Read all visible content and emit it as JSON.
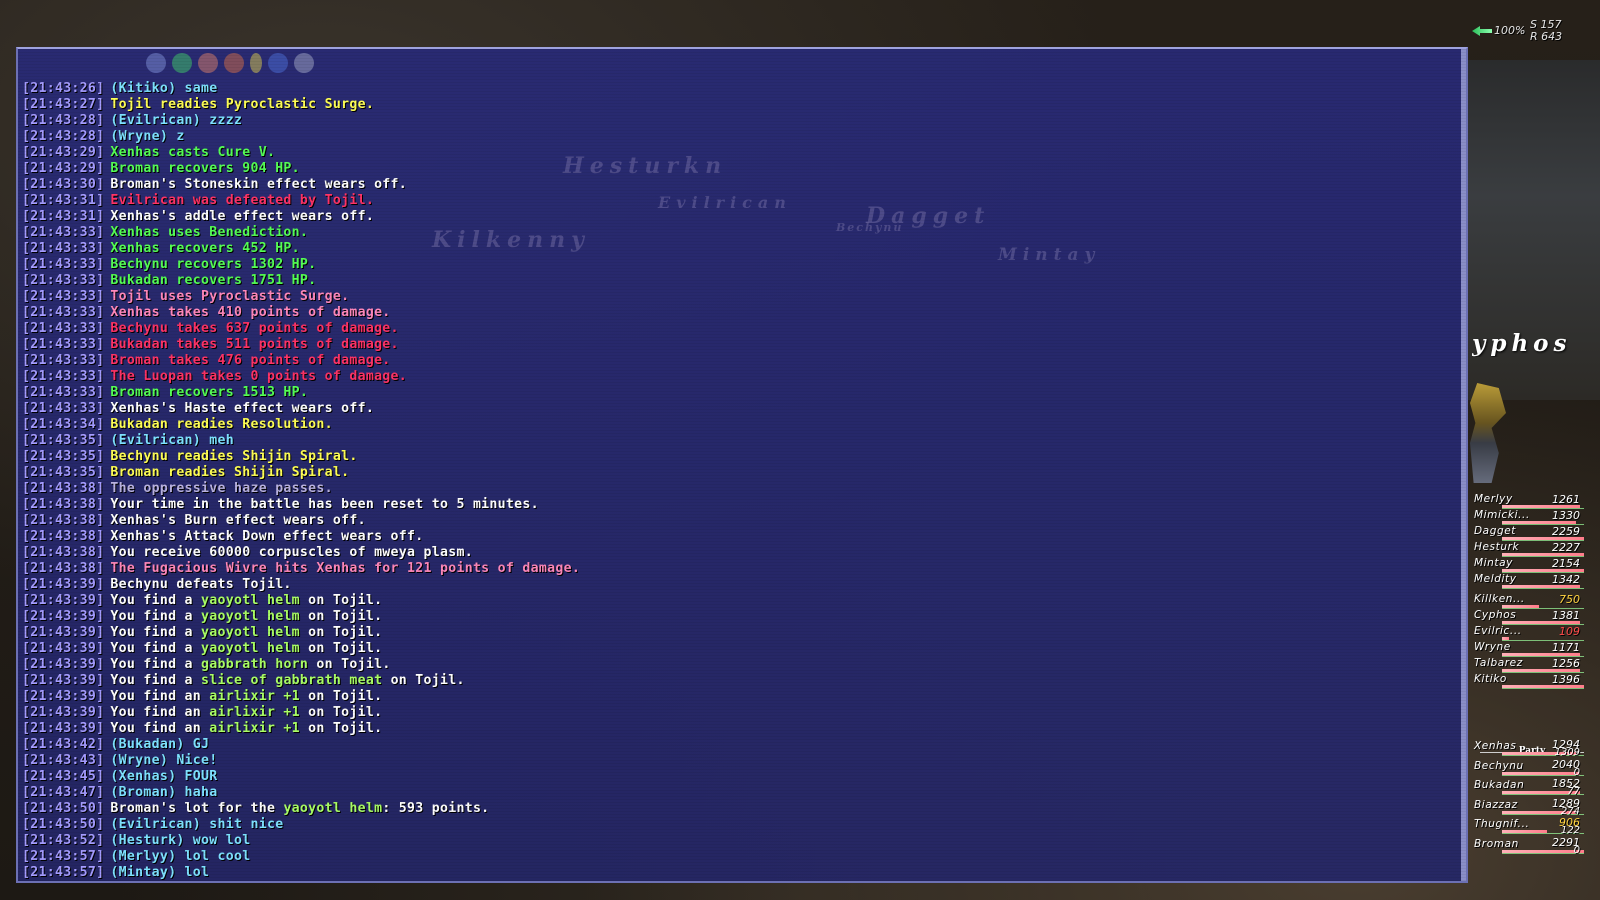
{
  "hud": {
    "zoom_percent": "100%",
    "s_value": "S 157",
    "r_value": "R 643"
  },
  "target": {
    "name": "yphos"
  },
  "ghost_names": [
    "Hesturkn",
    "Evilrican",
    "Dagget",
    "Kilkenny",
    "Mintay",
    "Bechynu"
  ],
  "chat_log": [
    {
      "ts": "[21:43:26]",
      "type": "chat",
      "segs": [
        {
          "t": "(Kitiko) same"
        }
      ]
    },
    {
      "ts": "[21:43:27]",
      "type": "ready",
      "segs": [
        {
          "t": "Tojil readies Pyroclastic Surge."
        }
      ]
    },
    {
      "ts": "[21:43:28]",
      "type": "chat",
      "segs": [
        {
          "t": "(Evilrican) zzzz"
        }
      ]
    },
    {
      "ts": "[21:43:28]",
      "type": "chat",
      "segs": [
        {
          "t": "(Wryne) z"
        }
      ]
    },
    {
      "ts": "[21:43:29]",
      "type": "heal",
      "segs": [
        {
          "t": "Xenhas casts Cure V."
        }
      ]
    },
    {
      "ts": "[21:43:29]",
      "type": "heal",
      "segs": [
        {
          "t": "Broman recovers 904 HP."
        }
      ]
    },
    {
      "ts": "[21:43:30]",
      "type": "white",
      "segs": [
        {
          "t": "Broman's Stoneskin effect wears off."
        }
      ]
    },
    {
      "ts": "[21:43:31]",
      "type": "defeat",
      "segs": [
        {
          "t": "Evilrican was defeated by Tojil."
        }
      ]
    },
    {
      "ts": "[21:43:31]",
      "type": "white",
      "segs": [
        {
          "t": "Xenhas's addle effect wears off."
        }
      ]
    },
    {
      "ts": "[21:43:33]",
      "type": "heal",
      "segs": [
        {
          "t": "Xenhas uses Benediction."
        }
      ]
    },
    {
      "ts": "[21:43:33]",
      "type": "heal",
      "segs": [
        {
          "t": "Xenhas recovers 452 HP."
        }
      ]
    },
    {
      "ts": "[21:43:33]",
      "type": "heal",
      "segs": [
        {
          "t": "Bechynu recovers 1302 HP."
        }
      ]
    },
    {
      "ts": "[21:43:33]",
      "type": "heal",
      "segs": [
        {
          "t": "Bukadan recovers 1751 HP."
        }
      ]
    },
    {
      "ts": "[21:43:33]",
      "type": "pink",
      "segs": [
        {
          "t": "Tojil uses Pyroclastic Surge."
        }
      ]
    },
    {
      "ts": "[21:43:33]",
      "type": "pink",
      "segs": [
        {
          "t": "Xenhas takes 410 points of damage."
        }
      ]
    },
    {
      "ts": "[21:43:33]",
      "type": "defeat",
      "segs": [
        {
          "t": "Bechynu takes 637 points of damage."
        }
      ]
    },
    {
      "ts": "[21:43:33]",
      "type": "defeat",
      "segs": [
        {
          "t": "Bukadan takes 511 points of damage."
        }
      ]
    },
    {
      "ts": "[21:43:33]",
      "type": "defeat",
      "segs": [
        {
          "t": "Broman takes 476 points of damage."
        }
      ]
    },
    {
      "ts": "[21:43:33]",
      "type": "defeat",
      "segs": [
        {
          "t": "The Luopan takes 0 points of damage."
        }
      ]
    },
    {
      "ts": "[21:43:33]",
      "type": "heal",
      "segs": [
        {
          "t": "Broman recovers 1513 HP."
        }
      ]
    },
    {
      "ts": "[21:43:33]",
      "type": "white",
      "segs": [
        {
          "t": "Xenhas's Haste effect wears off."
        }
      ]
    },
    {
      "ts": "[21:43:34]",
      "type": "ready",
      "segs": [
        {
          "t": "Bukadan readies Resolution."
        }
      ]
    },
    {
      "ts": "[21:43:35]",
      "type": "chat",
      "segs": [
        {
          "t": "(Evilrican) meh"
        }
      ]
    },
    {
      "ts": "[21:43:35]",
      "type": "ready",
      "segs": [
        {
          "t": "Bechynu readies Shijin Spiral."
        }
      ]
    },
    {
      "ts": "[21:43:35]",
      "type": "ready",
      "segs": [
        {
          "t": "Broman readies Shijin Spiral."
        }
      ]
    },
    {
      "ts": "[21:43:38]",
      "type": "grey",
      "segs": [
        {
          "t": "The oppressive haze passes."
        }
      ]
    },
    {
      "ts": "[21:43:38]",
      "type": "white",
      "segs": [
        {
          "t": "Your time in the battle has been reset to 5 minutes."
        }
      ]
    },
    {
      "ts": "[21:43:38]",
      "type": "white",
      "segs": [
        {
          "t": "Xenhas's Burn effect wears off."
        }
      ]
    },
    {
      "ts": "[21:43:38]",
      "type": "white",
      "segs": [
        {
          "t": "Xenhas's Attack Down effect wears off."
        }
      ]
    },
    {
      "ts": "[21:43:38]",
      "type": "white",
      "segs": [
        {
          "t": "You receive 60000 corpuscles of mweya plasm."
        }
      ]
    },
    {
      "ts": "[21:43:38]",
      "type": "pink",
      "segs": [
        {
          "t": "The Fugacious Wivre hits Xenhas for 121 points of damage."
        }
      ]
    },
    {
      "ts": "[21:43:39]",
      "type": "white",
      "segs": [
        {
          "t": "Bechynu defeats Tojil."
        }
      ]
    },
    {
      "ts": "[21:43:39]",
      "type": "white",
      "segs": [
        {
          "t": "You find a "
        },
        {
          "t": "yaoyotl helm",
          "item": true
        },
        {
          "t": " on Tojil."
        }
      ]
    },
    {
      "ts": "[21:43:39]",
      "type": "white",
      "segs": [
        {
          "t": "You find a "
        },
        {
          "t": "yaoyotl helm",
          "item": true
        },
        {
          "t": " on Tojil."
        }
      ]
    },
    {
      "ts": "[21:43:39]",
      "type": "white",
      "segs": [
        {
          "t": "You find a "
        },
        {
          "t": "yaoyotl helm",
          "item": true
        },
        {
          "t": " on Tojil."
        }
      ]
    },
    {
      "ts": "[21:43:39]",
      "type": "white",
      "segs": [
        {
          "t": "You find a "
        },
        {
          "t": "yaoyotl helm",
          "item": true
        },
        {
          "t": " on Tojil."
        }
      ]
    },
    {
      "ts": "[21:43:39]",
      "type": "white",
      "segs": [
        {
          "t": "You find a "
        },
        {
          "t": "gabbrath horn",
          "item": true
        },
        {
          "t": " on Tojil."
        }
      ]
    },
    {
      "ts": "[21:43:39]",
      "type": "white",
      "segs": [
        {
          "t": "You find a "
        },
        {
          "t": "slice of gabbrath meat",
          "item": true
        },
        {
          "t": " on Tojil."
        }
      ]
    },
    {
      "ts": "[21:43:39]",
      "type": "white",
      "segs": [
        {
          "t": "You find an "
        },
        {
          "t": "airlixir +1",
          "item": true
        },
        {
          "t": " on Tojil."
        }
      ]
    },
    {
      "ts": "[21:43:39]",
      "type": "white",
      "segs": [
        {
          "t": "You find an "
        },
        {
          "t": "airlixir +1",
          "item": true
        },
        {
          "t": " on Tojil."
        }
      ]
    },
    {
      "ts": "[21:43:39]",
      "type": "white",
      "segs": [
        {
          "t": "You find an "
        },
        {
          "t": "airlixir +1",
          "item": true
        },
        {
          "t": " on Tojil."
        }
      ]
    },
    {
      "ts": "[21:43:42]",
      "type": "chat",
      "segs": [
        {
          "t": "(Bukadan) GJ"
        }
      ]
    },
    {
      "ts": "[21:43:43]",
      "type": "chat",
      "segs": [
        {
          "t": "(Wryne) Nice!"
        }
      ]
    },
    {
      "ts": "[21:43:45]",
      "type": "chat",
      "segs": [
        {
          "t": "(Xenhas) FOUR"
        }
      ]
    },
    {
      "ts": "[21:43:47]",
      "type": "chat",
      "segs": [
        {
          "t": "(Broman) haha"
        }
      ]
    },
    {
      "ts": "[21:43:50]",
      "type": "white",
      "segs": [
        {
          "t": "Broman's lot for the "
        },
        {
          "t": "yaoyotl helm",
          "item": true
        },
        {
          "t": ": 593 points."
        }
      ]
    },
    {
      "ts": "[21:43:50]",
      "type": "chat",
      "segs": [
        {
          "t": "(Evilrican) shit nice"
        }
      ]
    },
    {
      "ts": "[21:43:52]",
      "type": "chat",
      "segs": [
        {
          "t": "(Hesturk) wow lol"
        }
      ]
    },
    {
      "ts": "[21:43:57]",
      "type": "chat",
      "segs": [
        {
          "t": "(Merlyy) lol cool"
        }
      ]
    },
    {
      "ts": "[21:43:57]",
      "type": "chat",
      "segs": [
        {
          "t": "(Mintay) lol"
        }
      ]
    }
  ],
  "alliance_1": [
    {
      "name": "Merlyy",
      "hp": "1261",
      "hp_frac": 0.95
    },
    {
      "name": "Mimicki...",
      "hp": "1330",
      "hp_frac": 0.9
    },
    {
      "name": "Dagget",
      "hp": "2259",
      "hp_frac": 1.0
    },
    {
      "name": "Hesturk",
      "hp": "2227",
      "hp_frac": 1.0
    },
    {
      "name": "Mintay",
      "hp": "2154",
      "hp_frac": 1.0
    },
    {
      "name": "Meldity",
      "hp": "1342",
      "hp_frac": 0.95
    }
  ],
  "alliance_2": [
    {
      "name": "Killken...",
      "hp": "750",
      "hp_frac": 0.45,
      "state": "low"
    },
    {
      "name": "Cyphos",
      "hp": "1381",
      "hp_frac": 0.95
    },
    {
      "name": "Evilric...",
      "hp": "109",
      "hp_frac": 0.08,
      "state": "crit"
    },
    {
      "name": "Wryne",
      "hp": "1171",
      "hp_frac": 0.95
    },
    {
      "name": "Talbarez",
      "hp": "1256",
      "hp_frac": 0.95
    },
    {
      "name": "Kitiko",
      "hp": "1396",
      "hp_frac": 1.0
    }
  ],
  "party": {
    "label": "Party",
    "members": [
      {
        "name": "Xenhas",
        "hp": "1294",
        "mp": "1309",
        "hp_frac": 0.9
      },
      {
        "name": "Bechynu",
        "hp": "2040",
        "mp": "0",
        "hp_frac": 0.95
      },
      {
        "name": "Bukadan",
        "hp": "1852",
        "mp": "77",
        "hp_frac": 0.95
      },
      {
        "name": "Biazzaz",
        "hp": "1289",
        "mp": "274",
        "hp_frac": 0.9
      },
      {
        "name": "Thugnif...",
        "hp": "906",
        "mp": "122",
        "hp_frac": 0.55,
        "state": "low"
      },
      {
        "name": "Broman",
        "hp": "2291",
        "mp": "0",
        "hp_frac": 1.0
      }
    ]
  },
  "colors": {
    "chat_bg": "#2a2c78",
    "timestamp": "#a59cff",
    "chat": "#7ee2ff",
    "ready": "#ffff55",
    "heal": "#55ff55",
    "defeat": "#ff3366",
    "item": "#aaff66"
  }
}
